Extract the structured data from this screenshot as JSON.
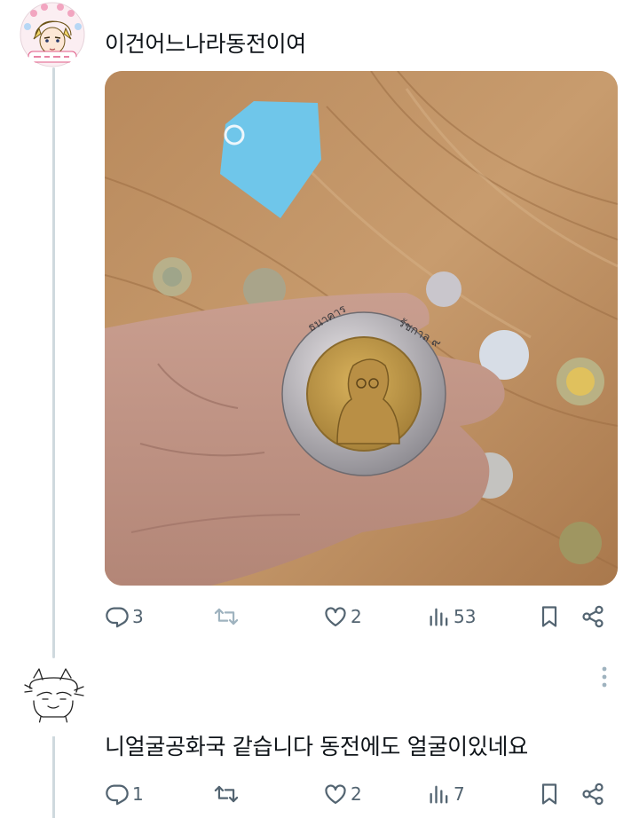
{
  "thread": {
    "post1": {
      "text": "이건어느나라동전이여",
      "actions": {
        "reply_count": "3",
        "repost_count": "",
        "like_count": "2",
        "view_count": "53"
      }
    },
    "post2": {
      "text": "니얼굴공화국 같습니다  동전에도 얼굴이있네요",
      "actions": {
        "reply_count": "1",
        "repost_count": "",
        "like_count": "2",
        "view_count": "7"
      }
    }
  },
  "icons": {
    "reply": "reply-icon",
    "repost": "repost-icon",
    "like": "heart-icon",
    "views": "views-icon",
    "bookmark": "bookmark-icon",
    "share": "share-icon",
    "more": "more-icon"
  },
  "colors": {
    "action_gray": "#536471",
    "repost_disabled": "#9fb3bf",
    "thread_line": "#cfd9de",
    "text": "#0f1419"
  }
}
